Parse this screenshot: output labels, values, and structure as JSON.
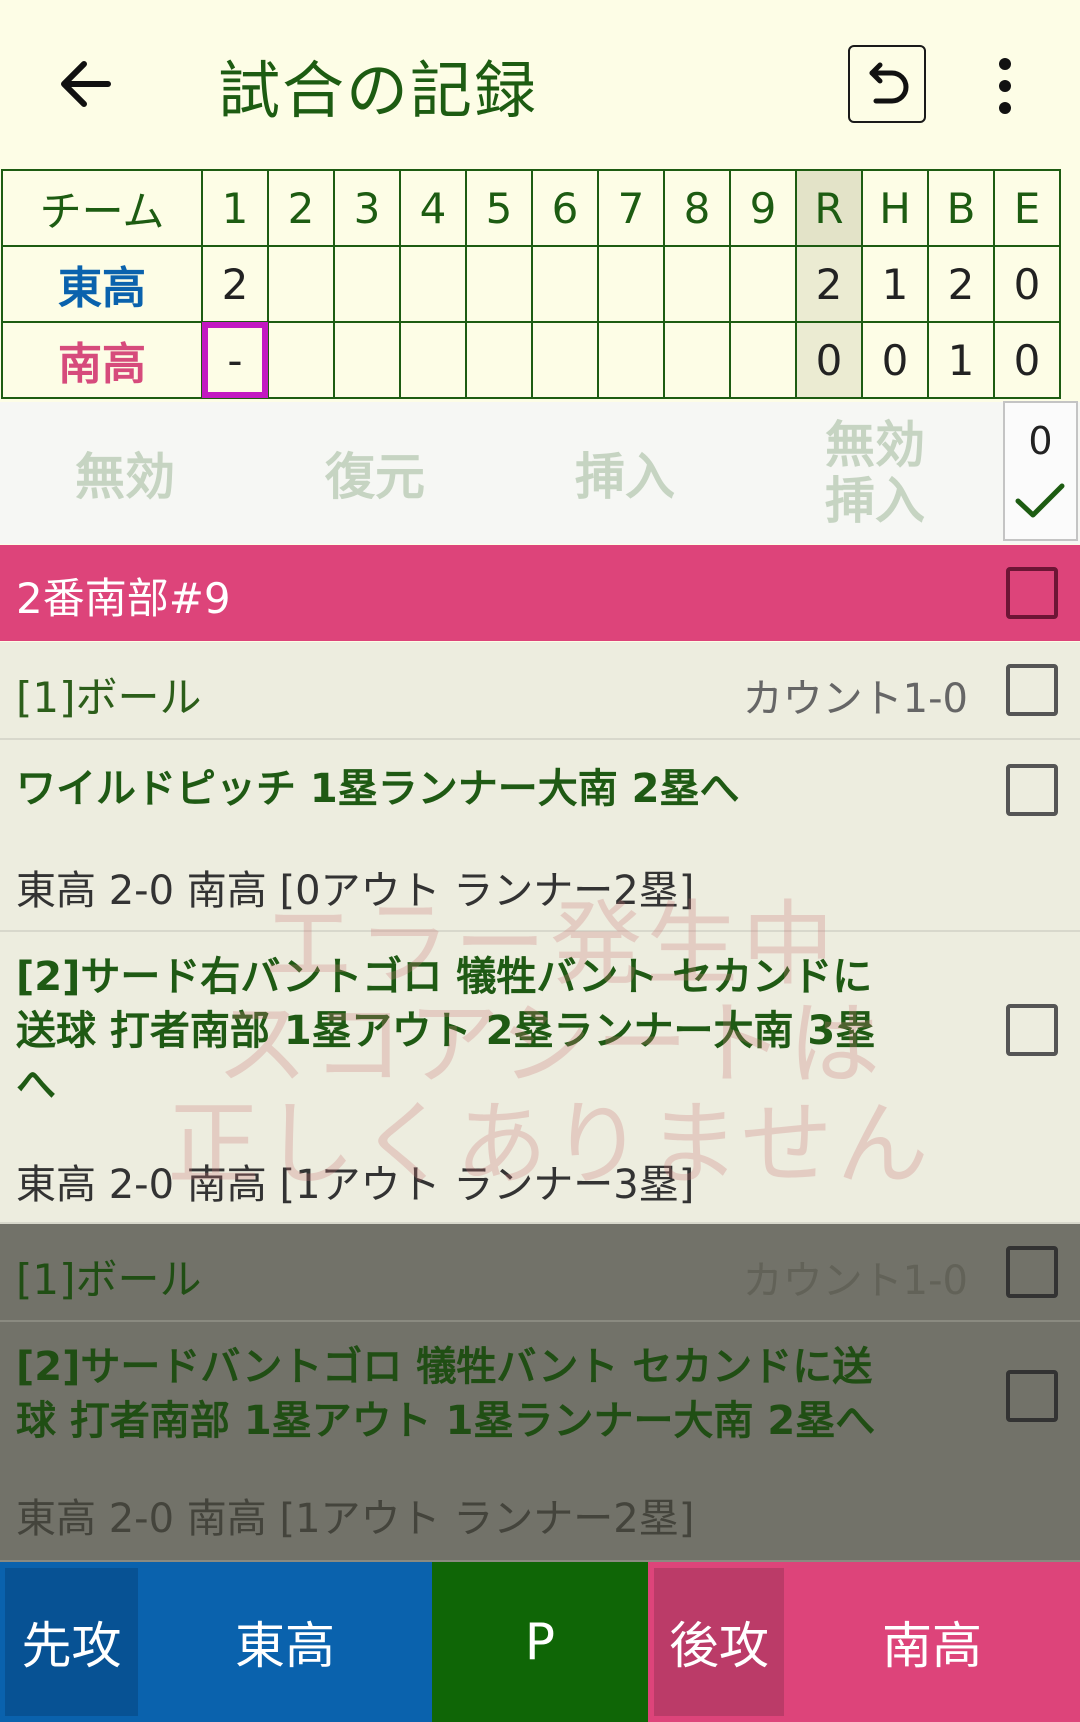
{
  "appbar": {
    "title": "試合の記録"
  },
  "score": {
    "header": {
      "team": "チーム",
      "innings": [
        "1",
        "2",
        "3",
        "4",
        "5",
        "6",
        "7",
        "8",
        "9"
      ],
      "totals": [
        "R",
        "H",
        "B",
        "E"
      ]
    },
    "away": {
      "name": "東高",
      "innings": [
        "2",
        "",
        "",
        "",
        "",
        "",
        "",
        "",
        ""
      ],
      "totals": [
        "2",
        "1",
        "2",
        "0"
      ]
    },
    "home": {
      "name": "南高",
      "innings": [
        "-",
        "",
        "",
        "",
        "",
        "",
        "",
        "",
        ""
      ],
      "totals": [
        "0",
        "0",
        "1",
        "0"
      ]
    }
  },
  "actions": {
    "invalid": "無効",
    "restore": "復元",
    "insert": "挿入",
    "invalid_insert_1": "無効",
    "invalid_insert_2": "挿入",
    "count": "0"
  },
  "batter": {
    "label": "2番南部#9"
  },
  "events": [
    {
      "text": "[1]ボール",
      "count": "カウント1-0"
    },
    {
      "text": "ワイルドピッチ 1塁ランナー大南 2塁へ",
      "state": "東高 2-0 南高 [0アウト ランナー2塁]"
    },
    {
      "text_1": "[2]サード右バントゴロ 犠牲バント セカンドに",
      "text_2": "送球 打者南部 1塁アウト 2塁ランナー大南 3塁",
      "text_3": "へ",
      "state": "東高 2-0 南高 [1アウト ランナー3塁]"
    },
    {
      "text": "[1]ボール",
      "count": "カウント1-0"
    },
    {
      "text_1": "[2]サードバントゴロ 犠牲バント セカンドに送",
      "text_2": "球 打者南部 1塁アウト 1塁ランナー大南 2塁へ",
      "state": "東高 2-0 南高 [1アウト ランナー2塁]"
    }
  ],
  "watermark": {
    "line1": "エラー発生中",
    "line2": "スコアシートは",
    "line3": "正しくありません"
  },
  "bottom": {
    "away_label": "先攻",
    "away_team": "東高",
    "pitcher": "P",
    "home_label": "後攻",
    "home_team": "南高"
  },
  "colors": {
    "away": "#0a62ad",
    "home": "#dd447a",
    "pitcher": "#0f6606",
    "highlight": "#c21ac2"
  }
}
